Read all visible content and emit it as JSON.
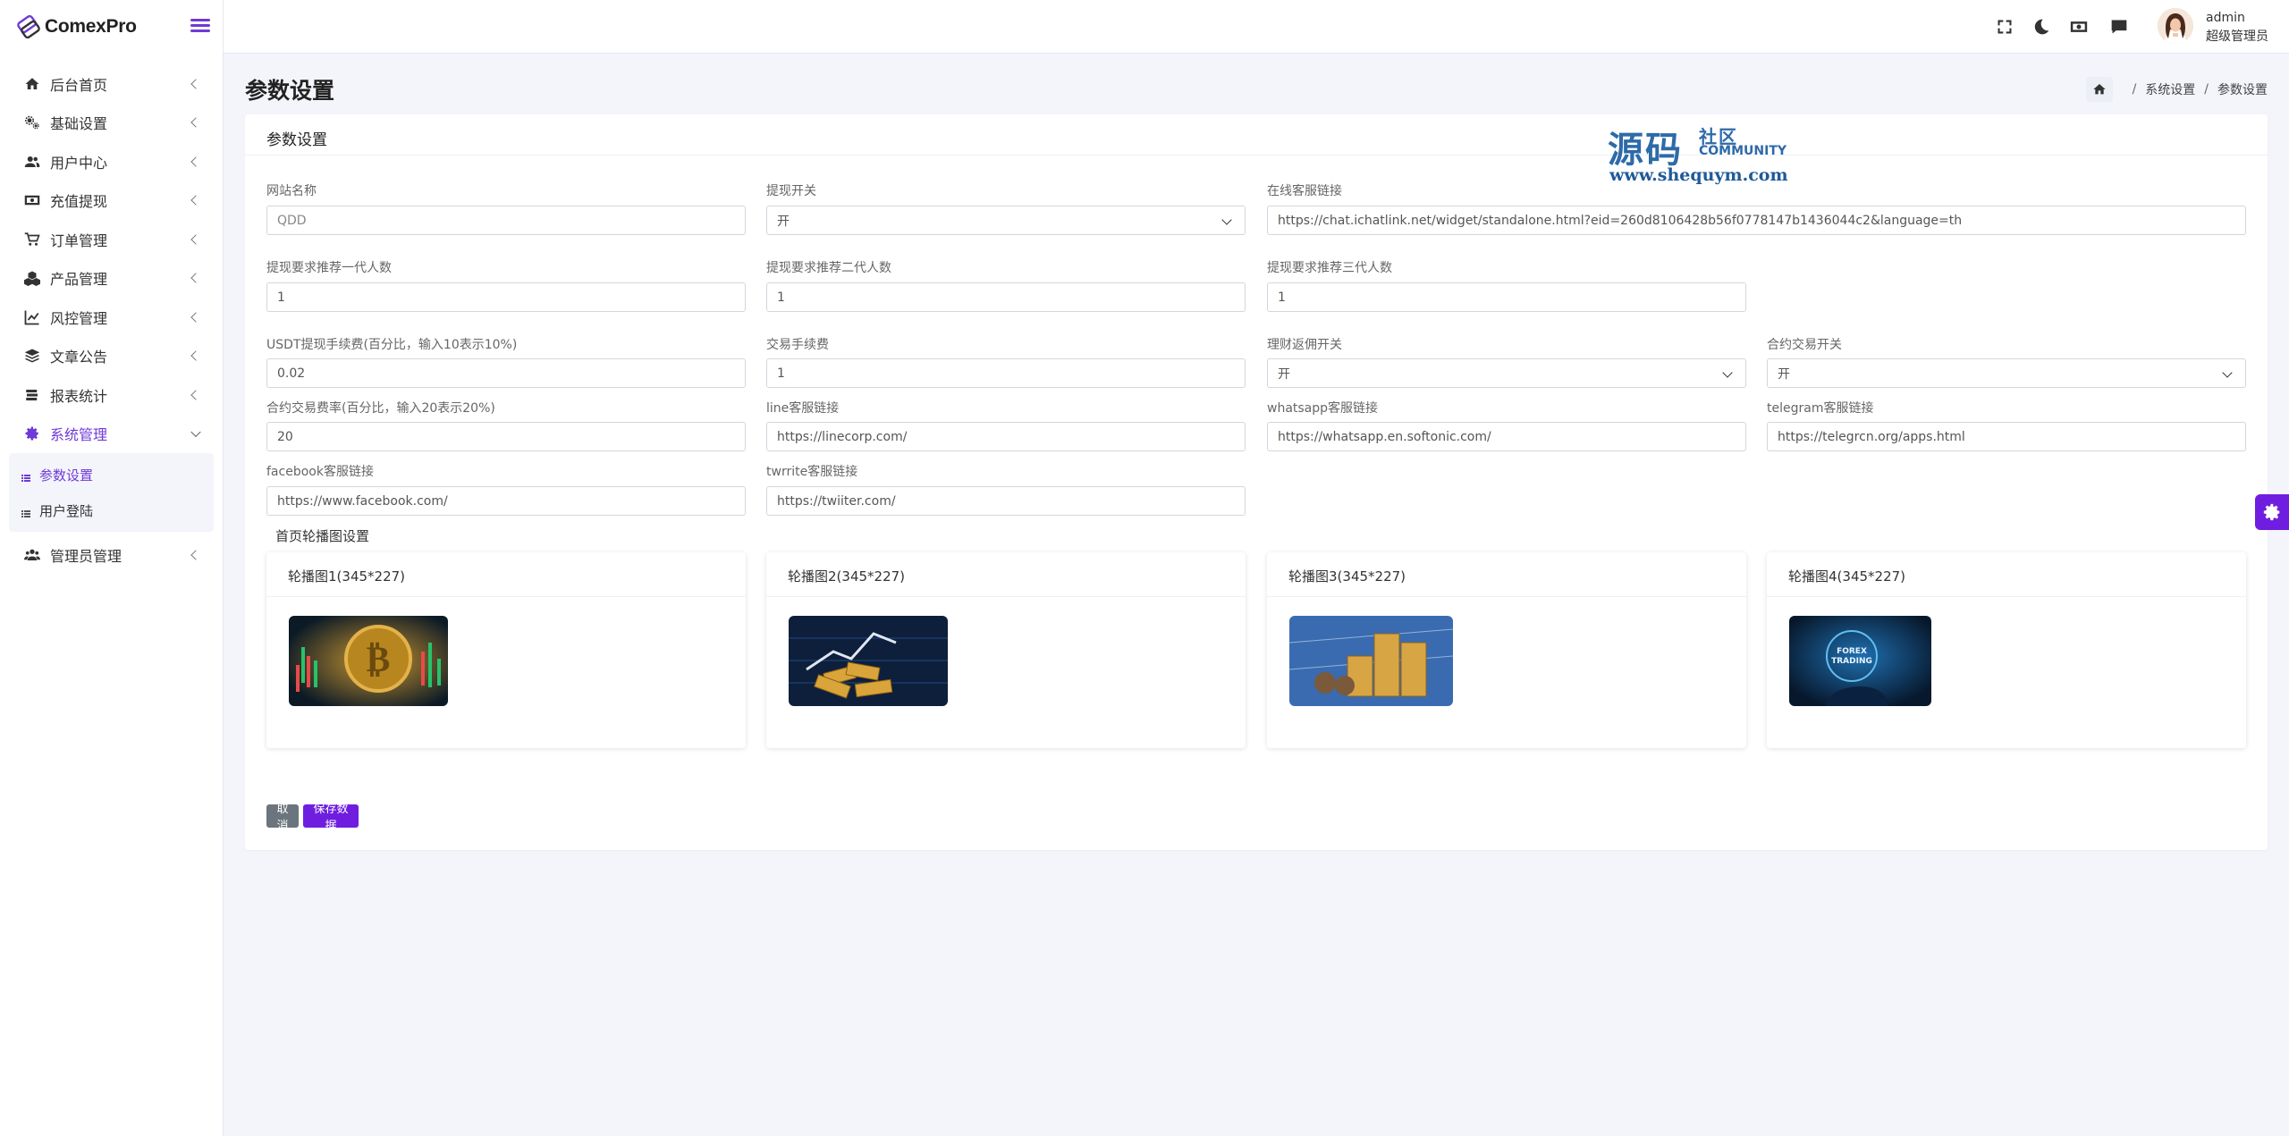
{
  "brand": {
    "name": "ComexPro"
  },
  "sidebar": {
    "items": [
      {
        "label": "后台首页",
        "icon": "home-icon"
      },
      {
        "label": "基础设置",
        "icon": "cogs-icon"
      },
      {
        "label": "用户中心",
        "icon": "users-icon"
      },
      {
        "label": "充值提现",
        "icon": "money-icon"
      },
      {
        "label": "订单管理",
        "icon": "cart-icon"
      },
      {
        "label": "产品管理",
        "icon": "cubes-icon"
      },
      {
        "label": "风控管理",
        "icon": "chart-line-icon"
      },
      {
        "label": "文章公告",
        "icon": "layers-icon"
      },
      {
        "label": "报表统计",
        "icon": "database-icon"
      },
      {
        "label": "系统管理",
        "icon": "gear-icon"
      },
      {
        "label": "管理员管理",
        "icon": "user-group-icon"
      }
    ],
    "subitems": [
      {
        "label": "参数设置",
        "active": true
      },
      {
        "label": "用户登陆",
        "active": false
      }
    ]
  },
  "topbar": {
    "user_name": "admin",
    "user_role": "超级管理员"
  },
  "page": {
    "title": "参数设置",
    "breadcrumb": [
      "系统设置",
      "参数设置"
    ]
  },
  "card": {
    "title": "参数设置"
  },
  "form": {
    "site_name": {
      "label": "网站名称",
      "value": "QDD"
    },
    "withdraw_switch": {
      "label": "提现开关",
      "value": "开"
    },
    "online_service_link": {
      "label": "在线客服链接",
      "value": "https://chat.ichatlink.net/widget/standalone.html?eid=260d8106428b56f0778147b1436044c2&language=th"
    },
    "withdraw_ref_1": {
      "label": "提现要求推荐一代人数",
      "value": "1"
    },
    "withdraw_ref_2": {
      "label": "提现要求推荐二代人数",
      "value": "1"
    },
    "withdraw_ref_3": {
      "label": "提现要求推荐三代人数",
      "value": "1"
    },
    "usdt_fee": {
      "label": "USDT提现手续费(百分比，输入10表示10%)",
      "value": "0.02"
    },
    "trade_fee": {
      "label": "交易手续费",
      "value": "1"
    },
    "finance_rebate_switch": {
      "label": "理财返佣开关",
      "value": "开"
    },
    "contract_switch": {
      "label": "合约交易开关",
      "value": "开"
    },
    "contract_fee_rate": {
      "label": "合约交易费率(百分比，输入20表示20%)",
      "value": "20"
    },
    "line_link": {
      "label": "line客服链接",
      "value": "https://linecorp.com/"
    },
    "whatsapp_link": {
      "label": "whatsapp客服链接",
      "value": "https://whatsapp.en.softonic.com/"
    },
    "telegram_link": {
      "label": "telegram客服链接",
      "value": "https://telegrcn.org/apps.html"
    },
    "facebook_link": {
      "label": "facebook客服链接",
      "value": "https://www.facebook.com/"
    },
    "twitter_link": {
      "label": "twrrite客服链接",
      "value": "https://twiiter.com/"
    }
  },
  "carousel": {
    "section_title": "首页轮播图设置",
    "slides": [
      {
        "title": "轮播图1(345*227)",
        "image": "bitcoin-chart-image"
      },
      {
        "title": "轮播图2(345*227)",
        "image": "gold-bars-image"
      },
      {
        "title": "轮播图3(345*227)",
        "image": "coin-stacks-image"
      },
      {
        "title": "轮播图4(345*227)",
        "image": "forex-trading-image",
        "image_text": "FOREX\nTRADING"
      }
    ]
  },
  "buttons": {
    "cancel": "取消",
    "save": "保存数据"
  },
  "watermark": {
    "main": "源码",
    "sub1": "社区",
    "sub2": "COMMUNITY",
    "url": "www.shequym.com"
  },
  "colors": {
    "accent": "#6f1ee0",
    "sidebar_active": "#6f3ad6",
    "cancel": "#6c757d",
    "watermark": "#2d6aa8"
  }
}
